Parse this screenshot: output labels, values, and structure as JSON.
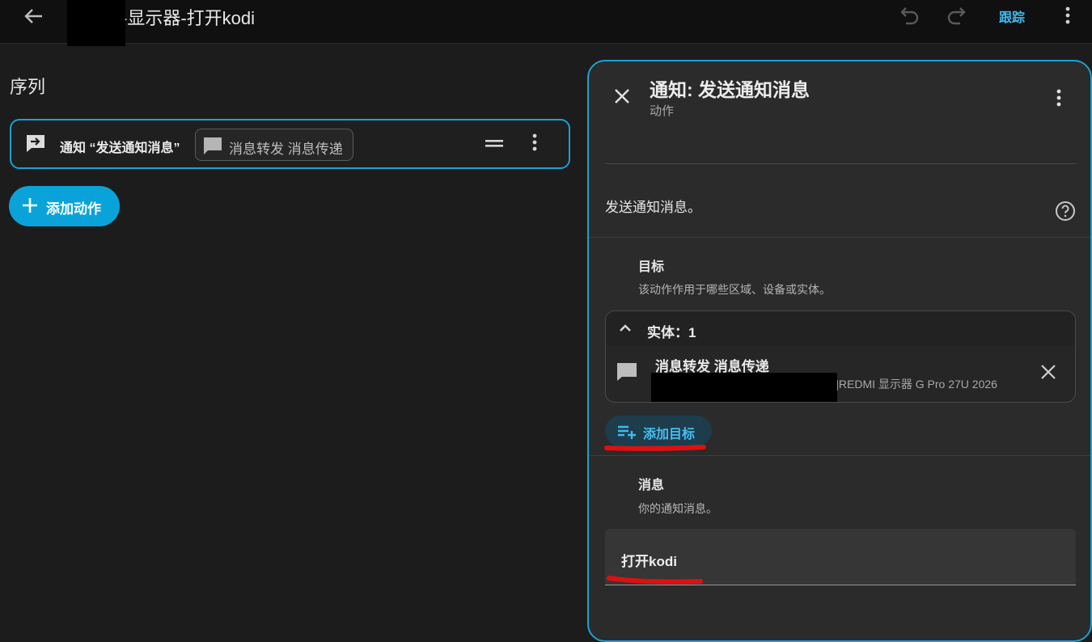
{
  "header": {
    "title": "-显示器-打开kodi",
    "trace_label": "跟踪",
    "icons": [
      "arrow-left-icon",
      "undo-icon",
      "redo-icon",
      "more-vertical-icon"
    ]
  },
  "sequence": {
    "title": "序列",
    "action_label": "通知 “发送通知消息”",
    "chip_label": "消息转发 消息传递",
    "add_action_label": "添加动作"
  },
  "panel": {
    "title": "通知: 发送通知消息",
    "subtitle": "动作",
    "description": "发送通知消息。",
    "target": {
      "label": "目标",
      "help": "该动作作用于哪些区域、设备或实体。",
      "entity_count_label": "实体：1",
      "entity_name": "消息转发 消息传递",
      "entity_device": "]REDMI 显示器 G Pro 27U 2026",
      "add_target_label": "添加目标"
    },
    "message": {
      "label": "消息",
      "help": "你的通知消息。",
      "value": "打开kodi"
    }
  },
  "colors": {
    "accent": "#1ba1d4",
    "add_action_bg": "#0aa3d9",
    "link": "#3fb9ef",
    "annotation_red": "#e01010"
  }
}
